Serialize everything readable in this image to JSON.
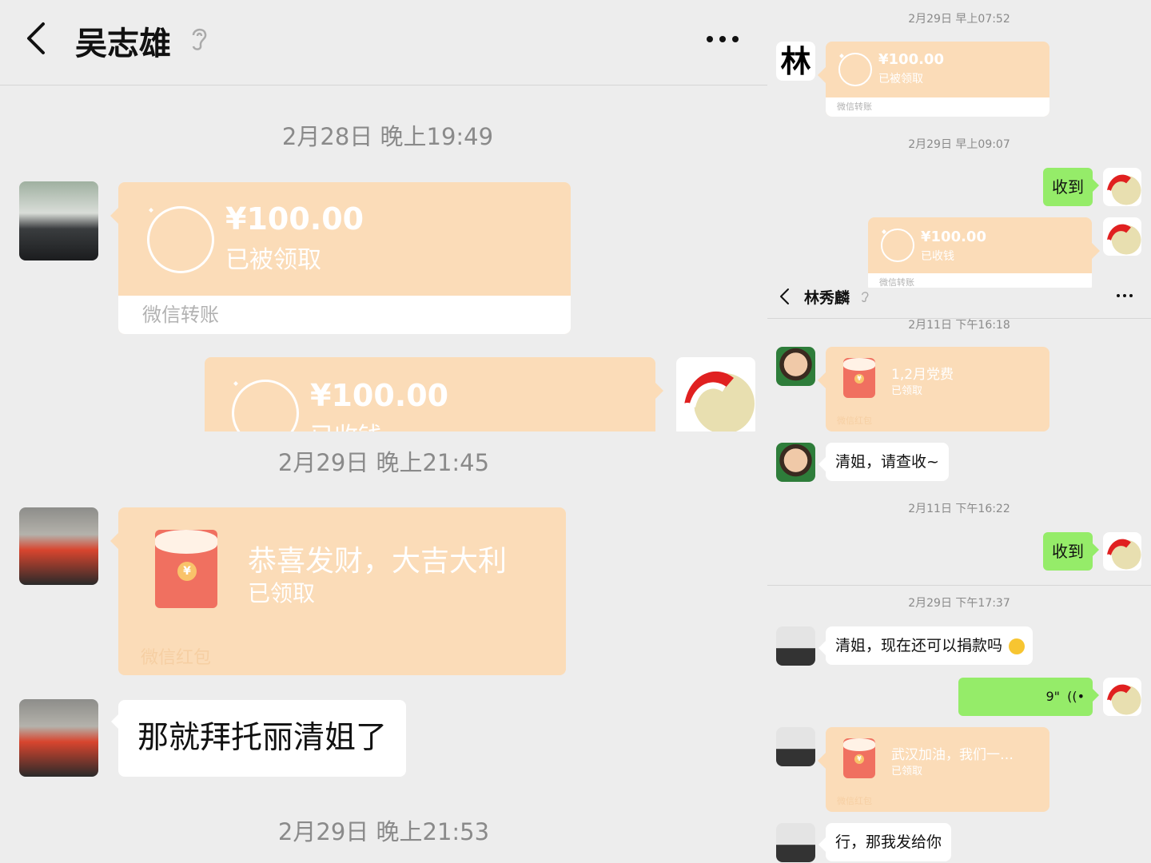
{
  "left": {
    "header": {
      "title": "吴志雄"
    },
    "timestamps": [
      "2月28日 晚上19:49",
      "2月29日 晚上21:45",
      "2月29日 晚上21:53"
    ],
    "transfer_received": {
      "amount": "¥100.00",
      "status": "已被领取",
      "footer": "微信转账"
    },
    "transfer_sent": {
      "amount": "¥100.00",
      "status": "已收钱"
    },
    "red_packet": {
      "message": "恭喜发财，大吉大利",
      "status": "已领取",
      "footer": "微信红包"
    },
    "text_message": "那就拜托丽清姐了"
  },
  "right_top": {
    "timestamps": [
      "2月29日 早上07:52",
      "2月29日 早上09:07"
    ],
    "transfer_received": {
      "amount": "¥100.00",
      "status": "已被领取",
      "footer": "微信转账"
    },
    "reply": "收到",
    "transfer_sent": {
      "amount": "¥100.00",
      "status": "已收钱",
      "footer": "微信转账"
    },
    "avatar_char": "林"
  },
  "right_bottom": {
    "header": {
      "title": "林秀麟"
    },
    "timestamps": [
      "2月11日 下午16:18",
      "2月11日 下午16:22",
      "2月29日 下午17:37"
    ],
    "red_packet_1": {
      "message": "1,2月党费",
      "status": "已领取",
      "footer": "微信红包"
    },
    "msg_1": "清姐，请查收~",
    "reply_1": "收到",
    "msg_2": "清姐，现在还可以捐款吗",
    "voice": "9\"",
    "red_packet_2": {
      "message": "武汉加油，我们一…",
      "status": "已领取",
      "footer": "微信红包"
    },
    "msg_3": "行，那我发给你"
  }
}
